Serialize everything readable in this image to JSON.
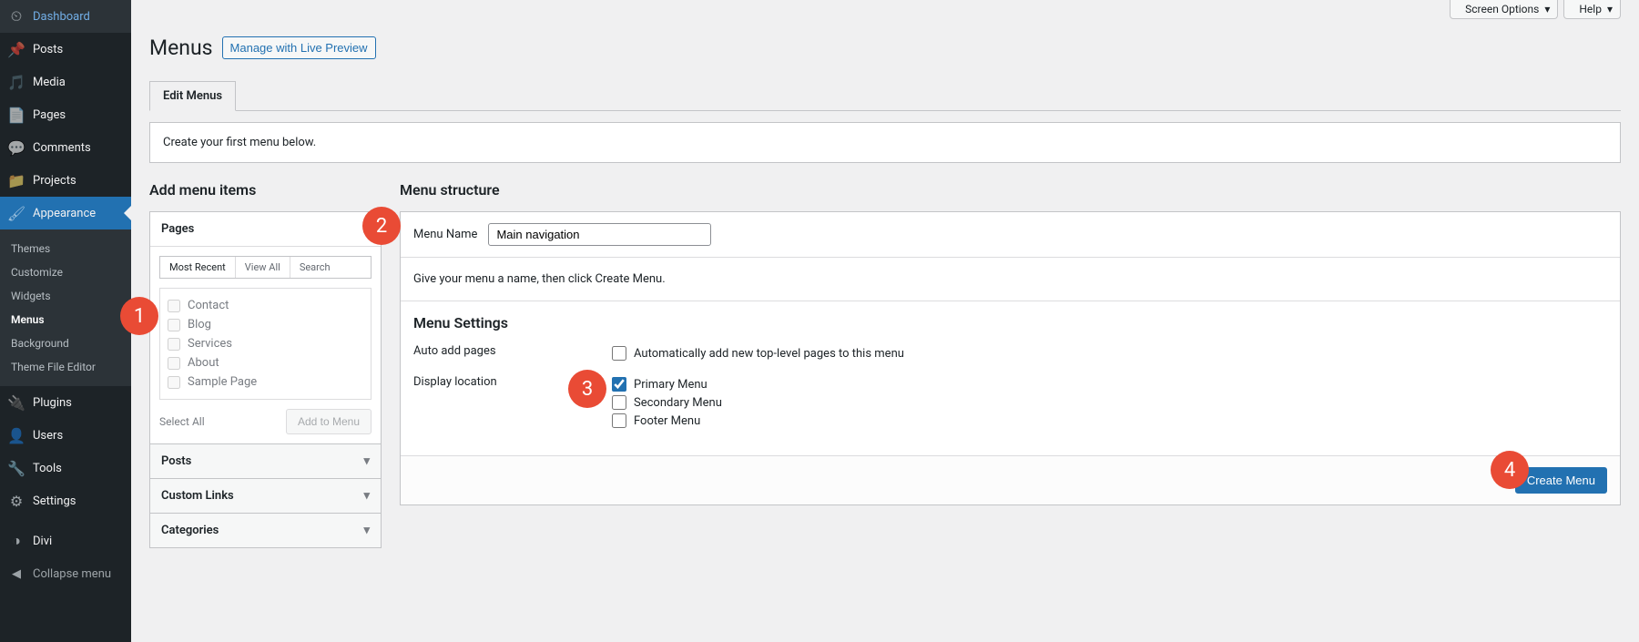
{
  "header": {
    "screen_options": "Screen Options",
    "help": "Help"
  },
  "page": {
    "title": "Menus",
    "live_preview_btn": "Manage with Live Preview",
    "tab_edit": "Edit Menus",
    "notice": "Create your first menu below."
  },
  "sidebar": {
    "items": [
      {
        "label": "Dashboard",
        "icon": "speedometer"
      },
      {
        "label": "Posts",
        "icon": "pin"
      },
      {
        "label": "Media",
        "icon": "media"
      },
      {
        "label": "Pages",
        "icon": "page"
      },
      {
        "label": "Comments",
        "icon": "comment"
      },
      {
        "label": "Projects",
        "icon": "projects"
      },
      {
        "label": "Appearance",
        "icon": "brush",
        "active": true
      },
      {
        "label": "Plugins",
        "icon": "plug"
      },
      {
        "label": "Users",
        "icon": "user"
      },
      {
        "label": "Tools",
        "icon": "wrench"
      },
      {
        "label": "Settings",
        "icon": "gear"
      },
      {
        "label": "Divi",
        "icon": "divi"
      }
    ],
    "submenu": [
      "Themes",
      "Customize",
      "Widgets",
      "Menus",
      "Background",
      "Theme File Editor"
    ],
    "collapse": "Collapse menu"
  },
  "add_items": {
    "title": "Add menu items",
    "pages_label": "Pages",
    "tabs": [
      "Most Recent",
      "View All",
      "Search"
    ],
    "pages": [
      "Contact",
      "Blog",
      "Services",
      "About",
      "Sample Page"
    ],
    "select_all": "Select All",
    "add_btn": "Add to Menu",
    "sections": [
      "Posts",
      "Custom Links",
      "Categories"
    ]
  },
  "structure": {
    "title": "Menu structure",
    "menu_name_label": "Menu Name",
    "menu_name_value": "Main navigation",
    "hint": "Give your menu a name, then click Create Menu.",
    "settings_title": "Menu Settings",
    "auto_add_label": "Auto add pages",
    "auto_add_option": "Automatically add new top-level pages to this menu",
    "display_loc_label": "Display location",
    "locations": [
      "Primary Menu",
      "Secondary Menu",
      "Footer Menu"
    ],
    "create_btn": "Create Menu"
  },
  "annotations": [
    "1",
    "2",
    "3",
    "4"
  ]
}
